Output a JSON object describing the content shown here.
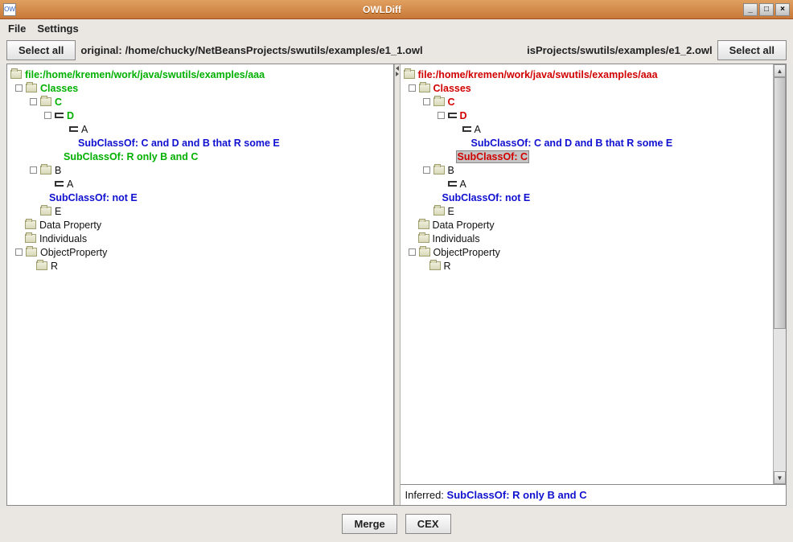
{
  "window": {
    "title": "OWLDiff"
  },
  "menubar": {
    "file": "File",
    "settings": "Settings"
  },
  "toolbar": {
    "select_all_left": "Select all",
    "select_all_right": "Select all",
    "original_label": "original:",
    "original_path": "/home/chucky/NetBeansProjects/swutils/examples/e1_1.owl",
    "compared_path": "isProjects/swutils/examples/e1_2.owl"
  },
  "left_tree": {
    "root": "file:/home/kremen/work/java/swutils/examples/aaa",
    "classes": "Classes",
    "c": "C",
    "d": "D",
    "a_under_d": "A",
    "axiom_d1": "SubClassOf: C and D and B that R some E",
    "axiom_d2": "SubClassOf: R only B and C",
    "b": "B",
    "a_under_b": "A",
    "axiom_b1": "SubClassOf: not E",
    "e": "E",
    "dataprop": "Data Property",
    "individuals": "Individuals",
    "objectprop": "ObjectProperty",
    "r": "R"
  },
  "right_tree": {
    "root": "file:/home/kremen/work/java/swutils/examples/aaa",
    "classes": "Classes",
    "c": "C",
    "d": "D",
    "a_under_d": "A",
    "axiom_d1": "SubClassOf: C and D and B that R some E",
    "axiom_d2": "SubClassOf: C",
    "b": "B",
    "a_under_b": "A",
    "axiom_b1": "SubClassOf: not E",
    "e": "E",
    "dataprop": "Data Property",
    "individuals": "Individuals",
    "objectprop": "ObjectProperty",
    "r": "R"
  },
  "infer": {
    "label": "Inferred:",
    "text": "SubClassOf: R only B and C"
  },
  "buttons": {
    "merge": "Merge",
    "cex": "CEX"
  }
}
